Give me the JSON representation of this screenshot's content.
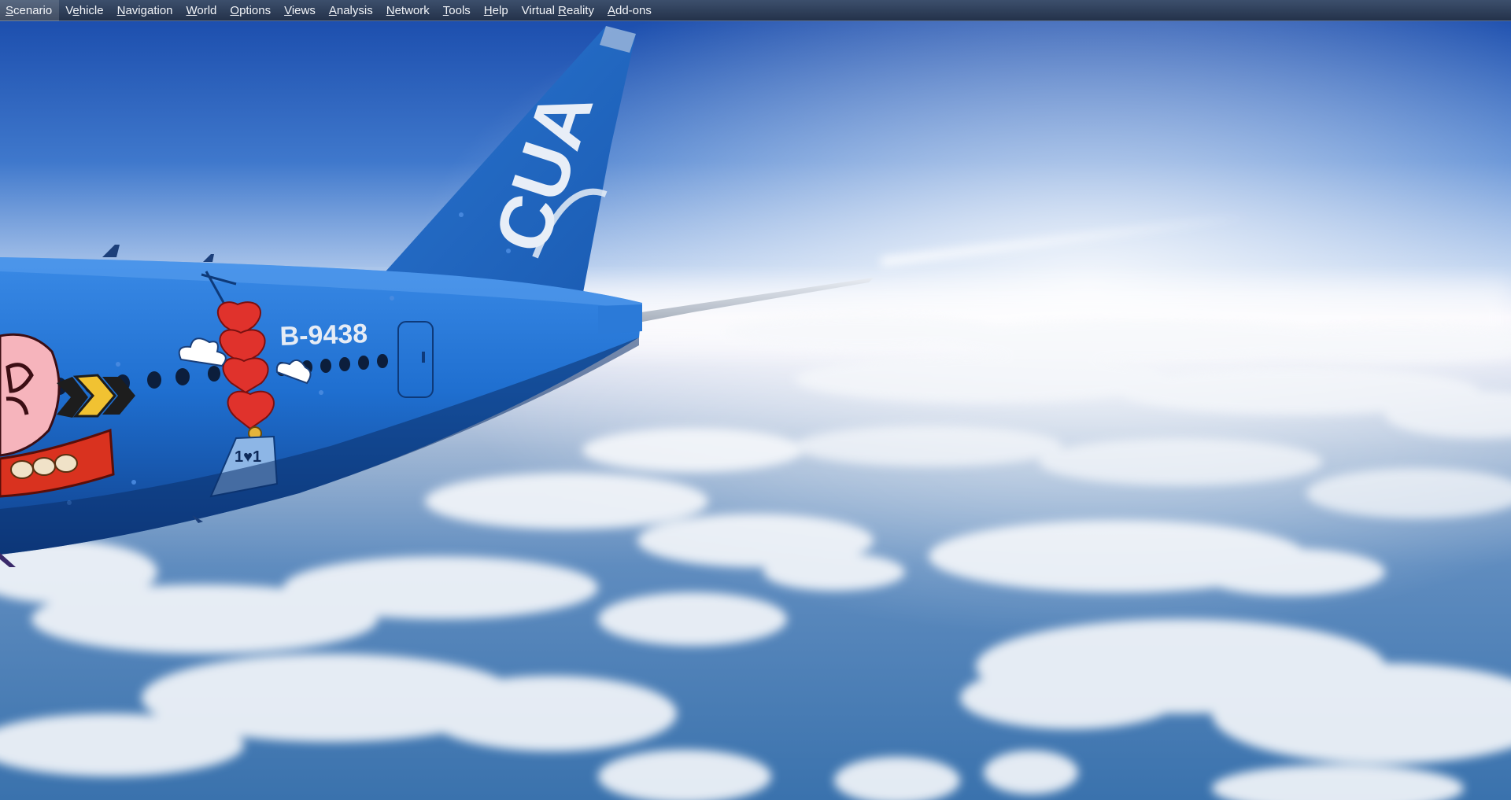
{
  "menubar": {
    "items": [
      {
        "pre": "",
        "key": "S",
        "post": "cenario"
      },
      {
        "pre": "V",
        "key": "e",
        "post": "hicle"
      },
      {
        "pre": "",
        "key": "N",
        "post": "avigation"
      },
      {
        "pre": "",
        "key": "W",
        "post": "orld"
      },
      {
        "pre": "",
        "key": "O",
        "post": "ptions"
      },
      {
        "pre": "",
        "key": "V",
        "post": "iews"
      },
      {
        "pre": "",
        "key": "A",
        "post": "nalysis"
      },
      {
        "pre": "",
        "key": "N",
        "post": "etwork"
      },
      {
        "pre": "",
        "key": "T",
        "post": "ools"
      },
      {
        "pre": "",
        "key": "H",
        "post": "elp"
      },
      {
        "pre": "Virtual ",
        "key": "R",
        "post": "eality"
      },
      {
        "pre": "",
        "key": "A",
        "post": "dd-ons"
      }
    ]
  },
  "scene": {
    "tail_logo": "CUA",
    "registration": "B-9438",
    "tower_sign": "1♥1",
    "colors": {
      "fuselage": "#1f6fd0",
      "fuselage_dark": "#1352a8",
      "sky_top": "#1d4fae",
      "sky_horizon": "#f4f2fa",
      "ocean": "#3e78b3",
      "heart": "#e0322c"
    }
  }
}
